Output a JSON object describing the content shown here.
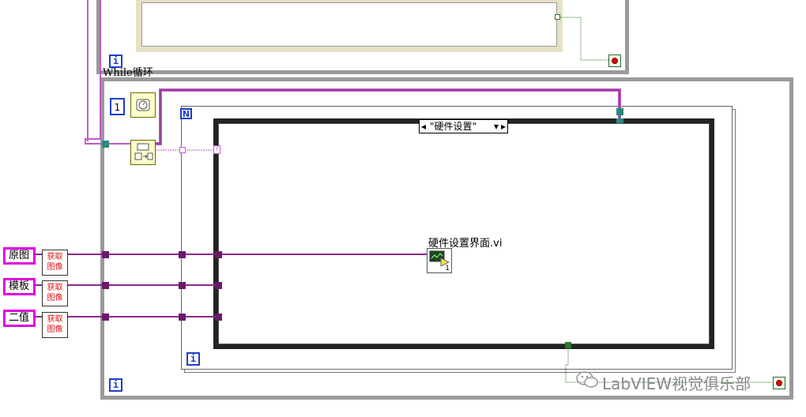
{
  "top_loop": {
    "iteration_terminal": "i",
    "label": "While循环"
  },
  "main_loop": {
    "iteration_terminal": "i"
  },
  "wait": {
    "constant": "1"
  },
  "for_loop": {
    "count_terminal": "N",
    "iteration_terminal": "i"
  },
  "case_structure": {
    "selector_value": "\"硬件设置\"",
    "left_arrow": "◂",
    "right_arrow": "▸",
    "dropdown": "▾"
  },
  "subvi": {
    "label": "硬件设置界面.vi",
    "terminal_number": "1"
  },
  "tunnel_marker": "?",
  "controls": [
    {
      "label": "原图",
      "function": "获取\n图像"
    },
    {
      "label": "模板",
      "function": "获取\n图像"
    },
    {
      "label": "二值",
      "function": "获取\n图像"
    }
  ],
  "watermark": "LabVIEW视觉俱乐部",
  "colors": {
    "image_wire": "#8b2a8b",
    "refnum_wire": "#c45ac4",
    "loop_border": "#9a9a9a",
    "accent_blue": "#1c3fc9",
    "control_border": "#e000e0"
  }
}
